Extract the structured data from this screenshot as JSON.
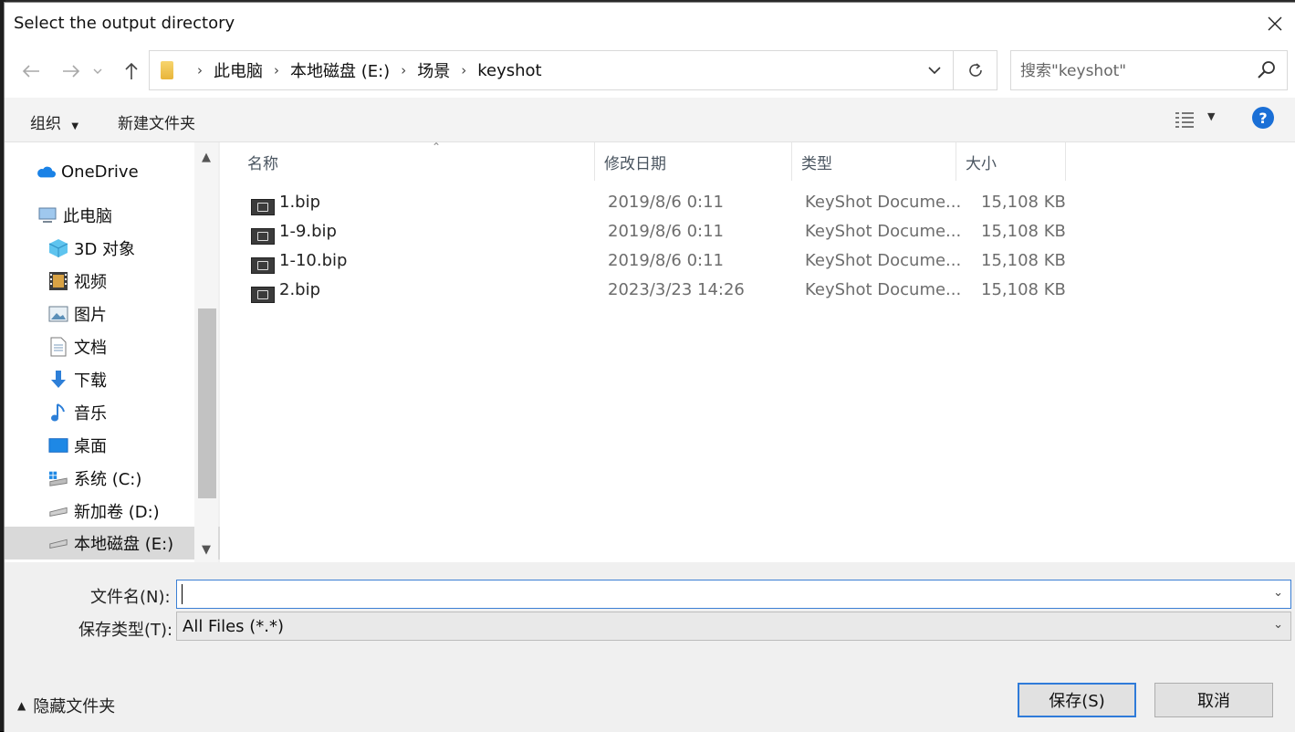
{
  "dialog": {
    "title": "Select the output directory",
    "close_icon": "close-icon"
  },
  "nav": {
    "back_icon": "back-arrow-icon",
    "forward_icon": "forward-arrow-icon",
    "recent_icon": "chevron-down-icon",
    "up_icon": "up-arrow-icon",
    "breadcrumb": [
      "此电脑",
      "本地磁盘 (E:)",
      "场景",
      "keyshot"
    ],
    "search_placeholder": "搜索\"keyshot\""
  },
  "toolbar": {
    "organize_label": "组织",
    "new_folder_label": "新建文件夹"
  },
  "sidebar": {
    "items": [
      {
        "label": "OneDrive",
        "icon": "cloud-icon"
      },
      {
        "label": "此电脑",
        "icon": "computer-icon"
      },
      {
        "label": "3D 对象",
        "icon": "cube-icon"
      },
      {
        "label": "视频",
        "icon": "video-icon"
      },
      {
        "label": "图片",
        "icon": "picture-icon"
      },
      {
        "label": "文档",
        "icon": "document-icon"
      },
      {
        "label": "下载",
        "icon": "download-icon"
      },
      {
        "label": "音乐",
        "icon": "music-icon"
      },
      {
        "label": "桌面",
        "icon": "desktop-icon"
      },
      {
        "label": "系统 (C:)",
        "icon": "system-drive-icon"
      },
      {
        "label": "新加卷 (D:)",
        "icon": "drive-icon"
      },
      {
        "label": "本地磁盘 (E:)",
        "icon": "drive-icon"
      }
    ],
    "selected_index": 11
  },
  "filelist": {
    "columns": [
      "名称",
      "修改日期",
      "类型",
      "大小"
    ],
    "rows": [
      {
        "name": "1.bip",
        "date": "2019/8/6 0:11",
        "type": "KeyShot Docume...",
        "size": "15,108 KB"
      },
      {
        "name": "1-9.bip",
        "date": "2019/8/6 0:11",
        "type": "KeyShot Docume...",
        "size": "15,108 KB"
      },
      {
        "name": "1-10.bip",
        "date": "2019/8/6 0:11",
        "type": "KeyShot Docume...",
        "size": "15,108 KB"
      },
      {
        "name": "2.bip",
        "date": "2023/3/23 14:26",
        "type": "KeyShot Docume...",
        "size": "15,108 KB"
      }
    ]
  },
  "bottom": {
    "filename_label": "文件名(N):",
    "filename_value": "",
    "filetype_label": "保存类型(T):",
    "filetype_value": "All Files (*.*)",
    "hide_folders_label": "隐藏文件夹",
    "save_label": "保存(S)",
    "cancel_label": "取消"
  },
  "colors": {
    "accent": "#2f7bd9",
    "selected_bg": "#d9d9d9",
    "help": "#1a6fd6"
  }
}
